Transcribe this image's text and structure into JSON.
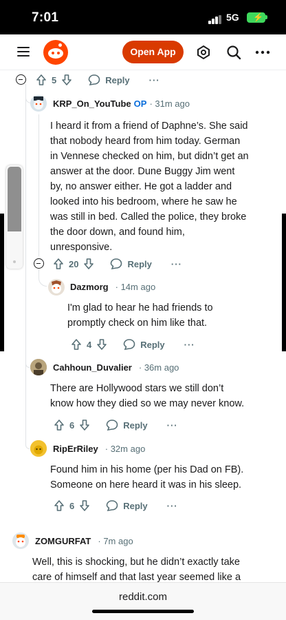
{
  "status_bar": {
    "time": "7:01",
    "network": "5G",
    "battery_icon": "battery-charging-icon"
  },
  "header": {
    "open_app_label": "Open App",
    "icons": [
      "menu-icon",
      "reddit-logo-icon",
      "user-shield-icon",
      "search-icon",
      "more-icon"
    ]
  },
  "thread": {
    "top_action": {
      "votes": "5",
      "reply_label": "Reply",
      "more_label": "···"
    },
    "comments": [
      {
        "author": "KRP_On_YouTube",
        "op_label": "OP",
        "time": "31m ago",
        "body": [
          "I heard it from a friend of Daphne’s. She said",
          "that nobody heard from him today. German",
          "in Vennese checked on him, but didn’t get an",
          "answer at the door. Dune Buggy Jim went",
          "by, no answer either. He got a ladder and",
          "looked into his bedroom, where he saw he",
          "was still in bed. Called the police, they broke",
          "the door down, and found him,",
          "unresponsive."
        ],
        "votes": "20",
        "reply_label": "Reply",
        "more_label": "···"
      },
      {
        "author": "Dazmorg",
        "time": "14m ago",
        "body": [
          "I'm glad to hear he had friends to",
          "promptly check on him like that."
        ],
        "votes": "4",
        "reply_label": "Reply",
        "more_label": "···"
      },
      {
        "author": "Cahhoun_Duvalier",
        "time": "36m ago",
        "body": [
          "There are Hollywood stars we still don’t",
          "know how they died so we may never know."
        ],
        "votes": "6",
        "reply_label": "Reply",
        "more_label": "···"
      },
      {
        "author": "RipErRiley",
        "time": "32m ago",
        "body": [
          "Found him in his home (per his Dad on FB).",
          "Someone on here heard it was in his sleep."
        ],
        "votes": "6",
        "reply_label": "Reply",
        "more_label": "···"
      },
      {
        "author": "ZOMGURFAT",
        "time": "7m ago",
        "body": [
          "Well, this is shocking, but he didn’t exactly take",
          "care of himself and that last year seemed like a"
        ]
      }
    ]
  },
  "url_bar": {
    "url": "reddit.com"
  },
  "colors": {
    "brand": "#ff4500",
    "open_app": "#d93a00",
    "op": "#0a6edb",
    "muted": "#576f76"
  }
}
